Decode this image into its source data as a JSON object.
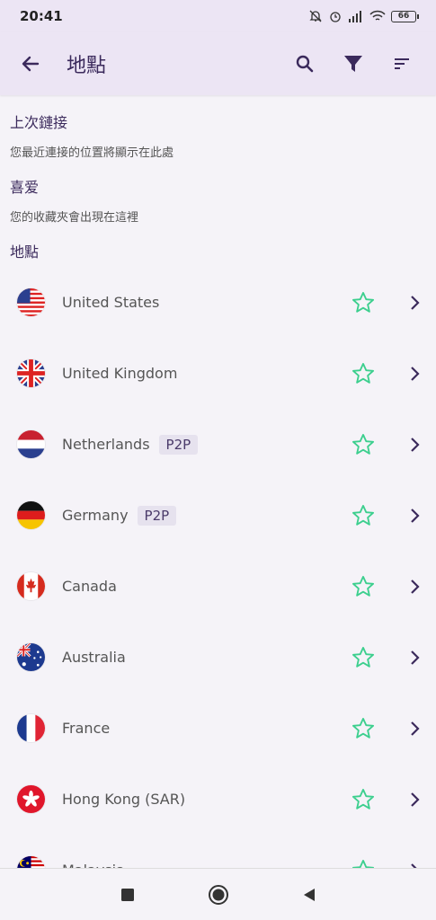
{
  "status": {
    "time": "20:41",
    "battery": "66"
  },
  "header": {
    "title": "地點"
  },
  "sections": {
    "recent_title": "上次鏈接",
    "recent_sub": "您最近連接的位置將顯示在此處",
    "fav_title": "喜爱",
    "fav_sub": "您的收藏夾會出現在這裡",
    "locations_title": "地點"
  },
  "locations": [
    {
      "name": "United States",
      "badge": ""
    },
    {
      "name": "United Kingdom",
      "badge": ""
    },
    {
      "name": "Netherlands",
      "badge": "P2P"
    },
    {
      "name": "Germany",
      "badge": "P2P"
    },
    {
      "name": "Canada",
      "badge": ""
    },
    {
      "name": "Australia",
      "badge": ""
    },
    {
      "name": "France",
      "badge": ""
    },
    {
      "name": "Hong Kong (SAR)",
      "badge": ""
    },
    {
      "name": "Malaysia",
      "badge": ""
    }
  ],
  "colors": {
    "accent": "#3b2a5c",
    "star": "#3ccf8e",
    "appbar": "#ece5f4"
  }
}
